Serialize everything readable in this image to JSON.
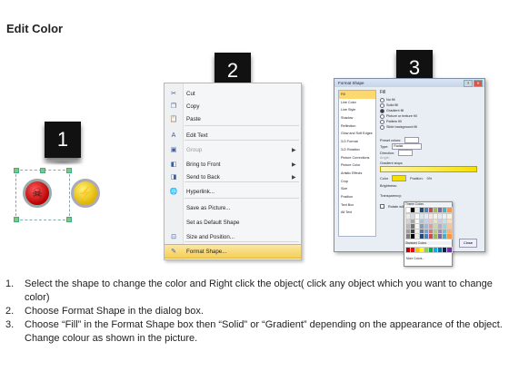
{
  "title": "Edit Color",
  "badges": [
    "1",
    "2",
    "3"
  ],
  "menu": {
    "items": [
      {
        "label": "Cut",
        "icon": "scissors-icon",
        "glyph": "✂",
        "disabled": false,
        "arrow": false,
        "highlight": false
      },
      {
        "label": "Copy",
        "icon": "copy-icon",
        "glyph": "❐",
        "disabled": false,
        "arrow": false,
        "highlight": false
      },
      {
        "label": "Paste",
        "icon": "paste-icon",
        "glyph": "📋",
        "disabled": false,
        "arrow": false,
        "highlight": false
      },
      {
        "label": "Edit Text",
        "icon": "edit-text-icon",
        "glyph": "A",
        "disabled": false,
        "arrow": false,
        "highlight": false
      },
      {
        "label": "Group",
        "icon": "group-icon",
        "glyph": "▣",
        "disabled": true,
        "arrow": true,
        "highlight": false
      },
      {
        "label": "Bring to Front",
        "icon": "bring-to-front-icon",
        "glyph": "◧",
        "disabled": false,
        "arrow": true,
        "highlight": false
      },
      {
        "label": "Send to Back",
        "icon": "send-to-back-icon",
        "glyph": "◨",
        "disabled": false,
        "arrow": true,
        "highlight": false
      },
      {
        "label": "Hyperlink...",
        "icon": "hyperlink-icon",
        "glyph": "🌐",
        "disabled": false,
        "arrow": false,
        "highlight": false
      },
      {
        "label": "Save as Picture...",
        "icon": "",
        "glyph": "",
        "disabled": false,
        "arrow": false,
        "highlight": false
      },
      {
        "label": "Set as Default Shape",
        "icon": "",
        "glyph": "",
        "disabled": false,
        "arrow": false,
        "highlight": false
      },
      {
        "label": "Size and Position...",
        "icon": "size-position-icon",
        "glyph": "⊡",
        "disabled": false,
        "arrow": false,
        "highlight": false
      },
      {
        "label": "Format Shape...",
        "icon": "format-shape-icon",
        "glyph": "✎",
        "disabled": false,
        "arrow": false,
        "highlight": true
      }
    ]
  },
  "dialog": {
    "title": "Format Shape",
    "categories": [
      "Fill",
      "Line Color",
      "Line Style",
      "Shadow",
      "Reflection",
      "Glow and Soft Edges",
      "3-D Format",
      "3-D Rotation",
      "Picture Corrections",
      "Picture Color",
      "Artistic Effects",
      "Crop",
      "Size",
      "Position",
      "Text Box",
      "Alt Text"
    ],
    "pane_heading": "Fill",
    "fill_options": [
      "No fill",
      "Solid fill",
      "Gradient fill",
      "Picture or texture fill",
      "Pattern fill",
      "Slide background fill"
    ],
    "selected_fill": 2,
    "fields": {
      "preset": "Preset colors:",
      "type": "Type:",
      "type_value": "Radial",
      "direction": "Direction:",
      "angle": "Angle:",
      "stops": "Gradient stops",
      "color": "Color",
      "position": "Position:",
      "position_value": "0%",
      "brightness": "Brightness:",
      "transparency": "Transparency:",
      "rotate": "Rotate with shape"
    },
    "palette": {
      "theme_label": "Theme Colors",
      "standard_label": "Standard Colors",
      "more": "More Colors..."
    },
    "close": "Close"
  },
  "instructions": [
    {
      "n": "1.",
      "text": "Select the shape to change the color and Right click the object( click any object which you want to change color)"
    },
    {
      "n": "2.",
      "text": "Choose Format Shape in the dialog box."
    },
    {
      "n": "3.",
      "text": "Choose “Fill” in the Format Shape box then “Solid” or “Gradient” depending on the appearance of the object. Change colour as shown in the picture."
    }
  ],
  "colors": {
    "highlight": "#f6cf57",
    "badge": "#111111",
    "red_icon": "#c80000",
    "yellow_icon": "#f0c800"
  }
}
